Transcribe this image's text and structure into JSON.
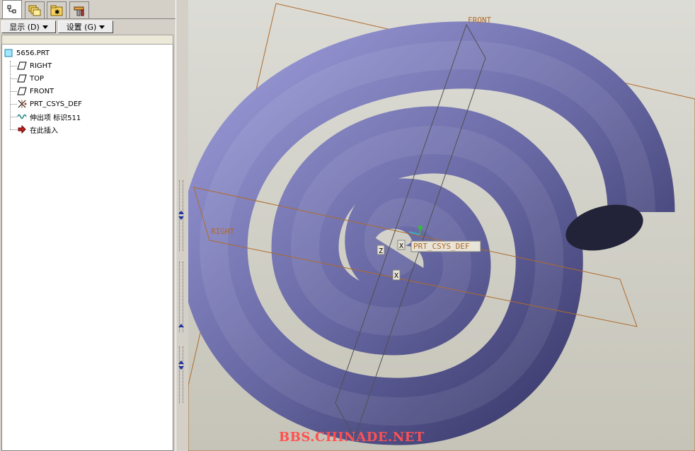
{
  "tabs": [
    {
      "icon": "model-tree-icon",
      "active": true
    },
    {
      "icon": "layers-icon",
      "active": false
    },
    {
      "icon": "folder-browser-icon",
      "active": false
    },
    {
      "icon": "tools-icon",
      "active": false
    }
  ],
  "toolbar": {
    "display_label": "显示 (D)",
    "settings_label": "设置 (G)"
  },
  "tree": {
    "items": [
      {
        "label": "5656.PRT",
        "icon": "part-icon"
      },
      {
        "label": "RIGHT",
        "icon": "datum-plane-icon"
      },
      {
        "label": "TOP",
        "icon": "datum-plane-icon"
      },
      {
        "label": "FRONT",
        "icon": "datum-plane-icon"
      },
      {
        "label": "PRT_CSYS_DEF",
        "icon": "coordinate-system-icon"
      },
      {
        "label": "伸出项 标识511",
        "icon": "protrusion-icon"
      },
      {
        "label": "在此插入",
        "icon": "insert-here-arrow-icon"
      }
    ]
  },
  "viewport": {
    "datum_labels": {
      "front": "FRONT",
      "right": "RIGHT",
      "csys": "PRT_CSYS_DEF"
    },
    "axis_labels": {
      "x1": "X",
      "z": "Z",
      "x2": "X"
    },
    "colors": {
      "datum": "#b06a2a",
      "surface": "#7a7ab8",
      "background": "#d0cec4"
    }
  },
  "watermark": "BBS.CHINADE.NET"
}
